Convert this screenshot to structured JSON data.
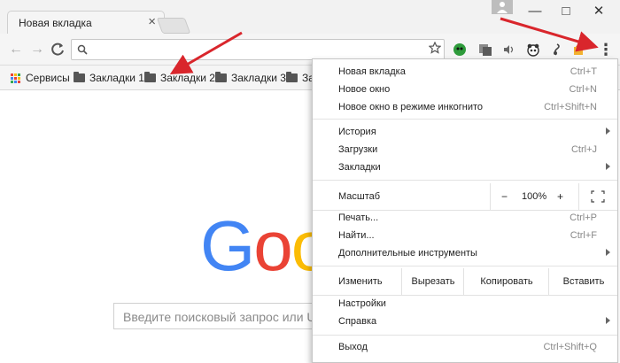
{
  "window": {
    "tab_title": "Новая вкладка",
    "tab_close_glyph": "×",
    "minimize_glyph": "—",
    "maximize_glyph": "□",
    "close_glyph": "✕"
  },
  "toolbar": {
    "back_glyph": "←",
    "forward_glyph": "→",
    "reload_glyph": "C",
    "menu_glyph": "⋮",
    "extensions": [
      {
        "name": "green-extension-icon",
        "color": "#2e9b3b"
      },
      {
        "name": "gray-extension-icon",
        "color": "#6f6f6f"
      },
      {
        "name": "audio-extension-icon",
        "color": "#8a8a8a"
      },
      {
        "name": "panda-extension-icon",
        "color": "#333333"
      },
      {
        "name": "music-extension-icon",
        "color": "#555555"
      },
      {
        "name": "yellow-extension-icon",
        "color": "#f2b230"
      }
    ]
  },
  "bookmarks": {
    "apps_label": "Сервисы",
    "items": [
      "Закладки 1",
      "Закладки 2",
      "Закладки 3",
      "За"
    ]
  },
  "page": {
    "logo_letters": [
      "G",
      "o",
      "o"
    ],
    "logo_colors": [
      "#4285f4",
      "#ea4335",
      "#fbbc05"
    ],
    "search_placeholder": "Введите поисковый запрос или URL"
  },
  "menu": {
    "new_tab": {
      "label": "Новая вкладка",
      "shortcut": "Ctrl+T"
    },
    "new_window": {
      "label": "Новое окно",
      "shortcut": "Ctrl+N"
    },
    "incognito": {
      "label": "Новое окно в режиме инкогнито",
      "shortcut": "Ctrl+Shift+N"
    },
    "history": {
      "label": "История"
    },
    "downloads": {
      "label": "Загрузки",
      "shortcut": "Ctrl+J"
    },
    "bookmarks": {
      "label": "Закладки"
    },
    "zoom": {
      "label": "Масштаб",
      "minus": "−",
      "value": "100%",
      "plus": "+"
    },
    "print": {
      "label": "Печать...",
      "shortcut": "Ctrl+P"
    },
    "find": {
      "label": "Найти...",
      "shortcut": "Ctrl+F"
    },
    "more_tools": {
      "label": "Дополнительные инструменты"
    },
    "edit": {
      "label": "Изменить",
      "cut": "Вырезать",
      "copy": "Копировать",
      "paste": "Вставить"
    },
    "settings": {
      "label": "Настройки"
    },
    "help": {
      "label": "Справка"
    },
    "exit": {
      "label": "Выход",
      "shortcut": "Ctrl+Shift+Q"
    }
  },
  "colors": {
    "annotation_arrow": "#d9262c"
  }
}
